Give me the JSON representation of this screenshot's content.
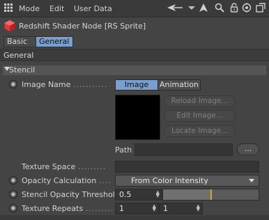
{
  "menu": {
    "mode": "Mode",
    "edit": "Edit",
    "user_data": "User Data"
  },
  "header": {
    "node_title": "Redshift Shader Node [RS Sprite]",
    "tabs": [
      {
        "label": "Basic",
        "active": false
      },
      {
        "label": "General",
        "active": true
      }
    ]
  },
  "section": {
    "title": "General"
  },
  "group": {
    "title": "Stencil"
  },
  "image_name": {
    "label": "Image Name",
    "modes": [
      "Image",
      "Animation"
    ],
    "active_mode": "Image",
    "reload_label": "Reload Image...",
    "edit_label": "Edit Image...",
    "locate_label": "Locate Image...",
    "path_label": "Path",
    "path_value": "",
    "browse_label": "..."
  },
  "texture_space": {
    "label": "Texture Space",
    "value": ""
  },
  "opacity_calculation": {
    "label": "Opacity Calculation",
    "value": "From Color Intensity"
  },
  "stencil_opacity_threshold": {
    "label": "Stencil Opacity Threshold",
    "value": "0.5",
    "fraction": 0.5
  },
  "texture_repeats": {
    "label": "Texture Repeats",
    "u": "1",
    "v": "1"
  },
  "colors": {
    "background": "#444444",
    "accent": "#7a9fcf",
    "slider_handle": "#f0a020",
    "logo": "#e0393e"
  }
}
